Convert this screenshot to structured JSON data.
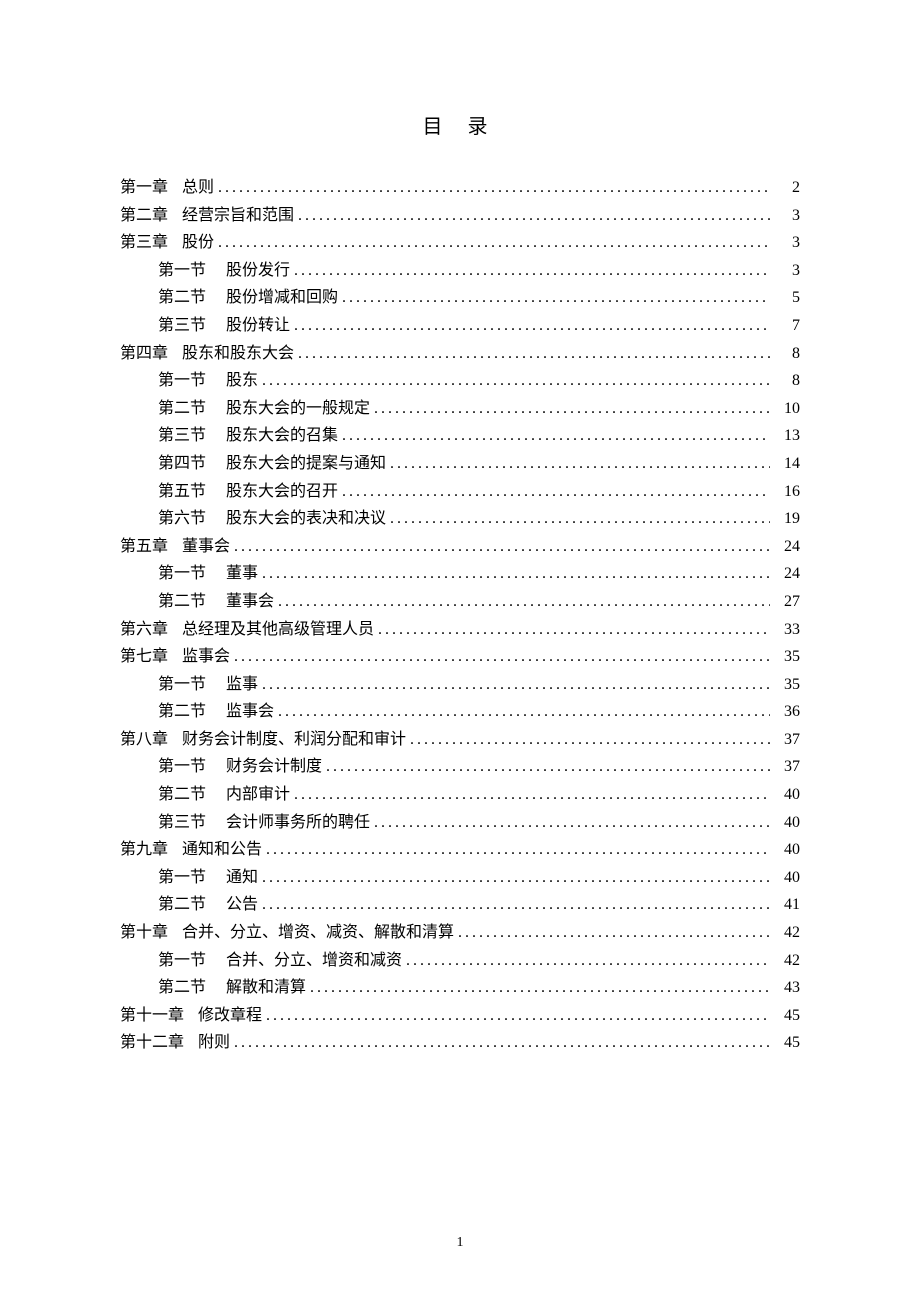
{
  "title": "目   录",
  "entries": [
    {
      "level": 0,
      "prefix": "第一章",
      "name": "总则",
      "page": "2"
    },
    {
      "level": 0,
      "prefix": "第二章",
      "name": "经营宗旨和范围",
      "page": "3"
    },
    {
      "level": 0,
      "prefix": "第三章",
      "name": "股份",
      "page": "3"
    },
    {
      "level": 1,
      "prefix": "第一节",
      "name": "股份发行",
      "page": "3"
    },
    {
      "level": 1,
      "prefix": "第二节",
      "name": "股份增减和回购",
      "page": "5"
    },
    {
      "level": 1,
      "prefix": "第三节",
      "name": "股份转让",
      "page": "7"
    },
    {
      "level": 0,
      "prefix": "第四章",
      "name": "股东和股东大会",
      "page": "8"
    },
    {
      "level": 1,
      "prefix": "第一节",
      "name": "股东",
      "page": "8"
    },
    {
      "level": 1,
      "prefix": "第二节",
      "name": "股东大会的一般规定",
      "page": "10"
    },
    {
      "level": 1,
      "prefix": "第三节",
      "name": "股东大会的召集",
      "page": "13"
    },
    {
      "level": 1,
      "prefix": "第四节",
      "name": "股东大会的提案与通知",
      "page": "14"
    },
    {
      "level": 1,
      "prefix": "第五节",
      "name": "股东大会的召开",
      "page": "16"
    },
    {
      "level": 1,
      "prefix": "第六节",
      "name": "股东大会的表决和决议",
      "page": "19"
    },
    {
      "level": 0,
      "prefix": "第五章",
      "name": "董事会",
      "page": "24"
    },
    {
      "level": 1,
      "prefix": "第一节",
      "name": "董事",
      "page": "24"
    },
    {
      "level": 1,
      "prefix": "第二节",
      "name": "董事会",
      "page": "27"
    },
    {
      "level": 0,
      "prefix": "第六章",
      "name": "总经理及其他高级管理人员",
      "page": "33"
    },
    {
      "level": 0,
      "prefix": "第七章",
      "name": "监事会",
      "page": "35"
    },
    {
      "level": 1,
      "prefix": "第一节",
      "name": "监事",
      "page": "35"
    },
    {
      "level": 1,
      "prefix": "第二节",
      "name": "监事会",
      "page": "36"
    },
    {
      "level": 0,
      "prefix": "第八章",
      "name": "财务会计制度、利润分配和审计",
      "page": "37"
    },
    {
      "level": 1,
      "prefix": "第一节",
      "name": "财务会计制度",
      "page": "37"
    },
    {
      "level": 1,
      "prefix": "第二节",
      "name": "内部审计",
      "page": "40"
    },
    {
      "level": 1,
      "prefix": "第三节",
      "name": "会计师事务所的聘任",
      "page": "40"
    },
    {
      "level": 0,
      "prefix": "第九章",
      "name": "通知和公告",
      "page": "40"
    },
    {
      "level": 1,
      "prefix": "第一节",
      "name": "通知",
      "page": "40"
    },
    {
      "level": 1,
      "prefix": "第二节",
      "name": "公告",
      "page": "41"
    },
    {
      "level": 0,
      "prefix": "第十章",
      "name": "合并、分立、增资、减资、解散和清算",
      "page": "42"
    },
    {
      "level": 1,
      "prefix": "第一节",
      "name": "合并、分立、增资和减资",
      "page": "42"
    },
    {
      "level": 1,
      "prefix": "第二节",
      "name": "解散和清算",
      "page": "43"
    },
    {
      "level": 0,
      "prefix": "第十一章",
      "name": "修改章程",
      "page": "45"
    },
    {
      "level": 0,
      "prefix": "第十二章",
      "name": "附则",
      "page": "45"
    }
  ],
  "footer": "1"
}
